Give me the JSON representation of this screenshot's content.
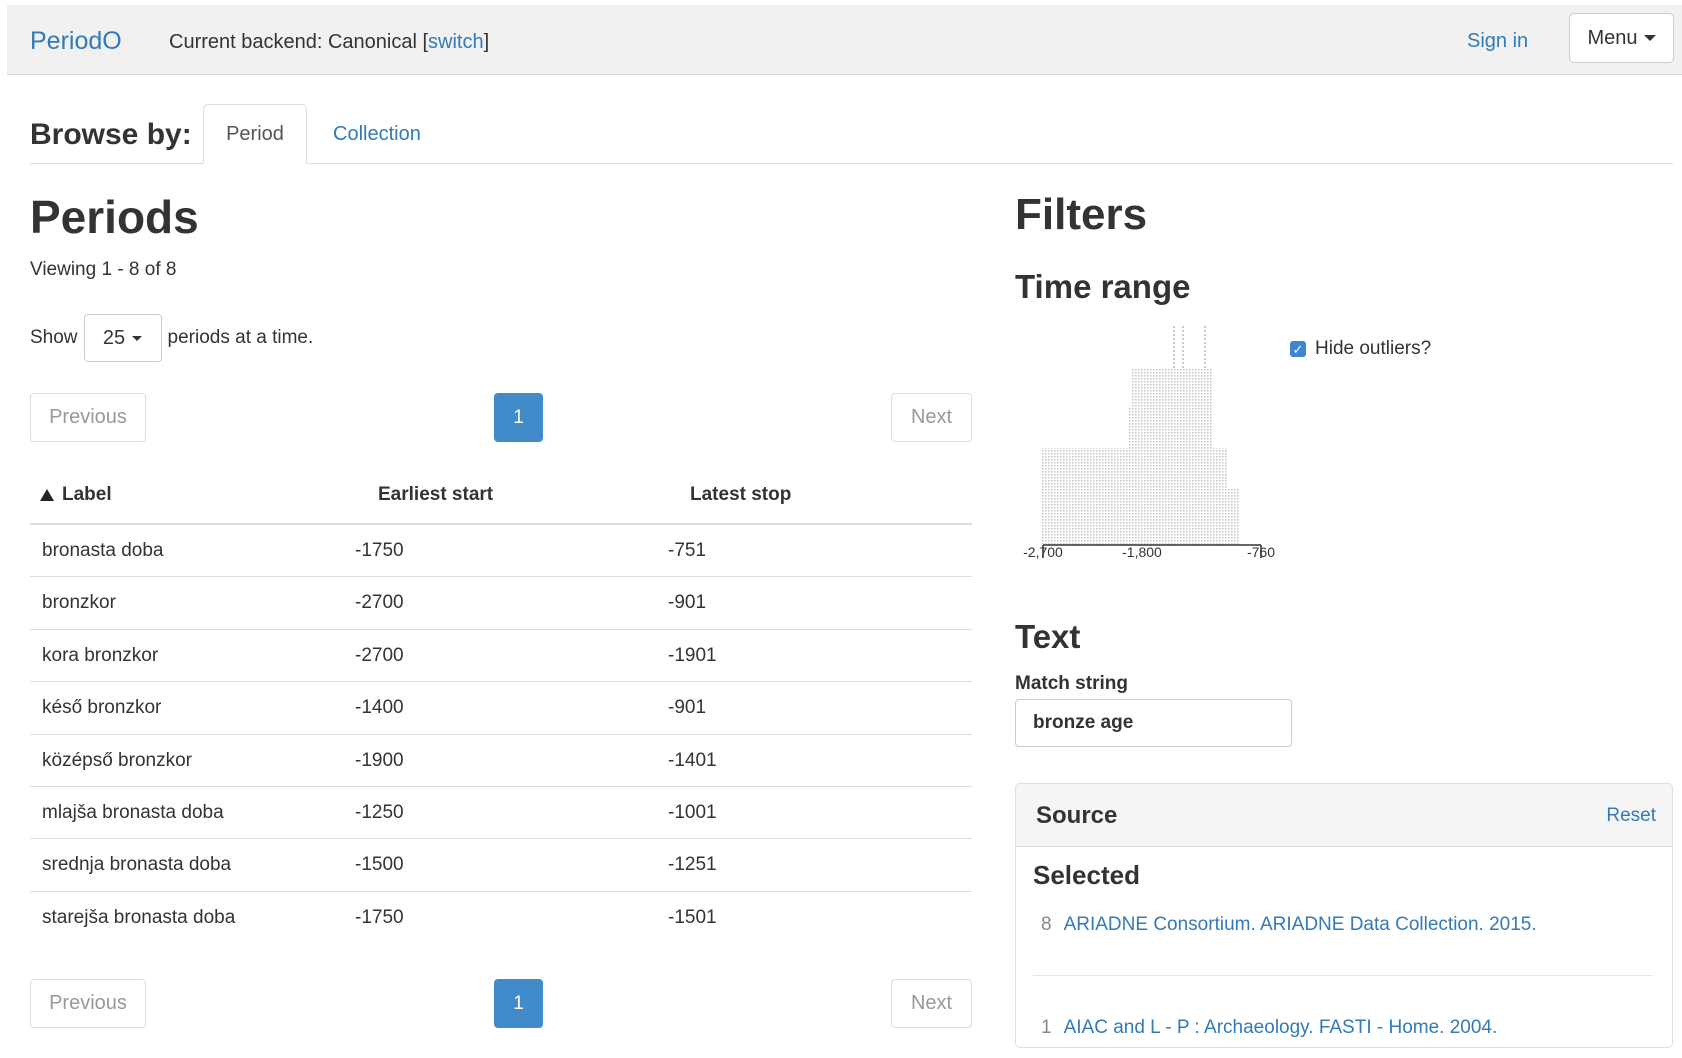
{
  "navbar": {
    "brand": "PeriodO",
    "backend_prefix": "Current backend: Canonical [",
    "backend_switch": "switch",
    "backend_suffix": "]",
    "sign_in": "Sign in",
    "menu": "Menu"
  },
  "browse": {
    "label": "Browse by:",
    "tabs": [
      {
        "label": "Period",
        "active": true
      },
      {
        "label": "Collection",
        "active": false
      }
    ]
  },
  "periods": {
    "title": "Periods",
    "viewing": "Viewing 1 - 8 of 8",
    "show_prefix": "Show",
    "show_value": "25",
    "show_suffix": "periods at a time.",
    "pager": {
      "previous": "Previous",
      "page": "1",
      "next": "Next"
    },
    "columns": {
      "label": "Label",
      "earliest_start": "Earliest start",
      "latest_stop": "Latest stop"
    },
    "rows": [
      {
        "label": "bronasta doba",
        "start": "-1750",
        "stop": "-751"
      },
      {
        "label": "bronzkor",
        "start": "-2700",
        "stop": "-901"
      },
      {
        "label": "kora bronzkor",
        "start": "-2700",
        "stop": "-1901"
      },
      {
        "label": "késő bronzkor",
        "start": "-1400",
        "stop": "-901"
      },
      {
        "label": "középső bronzkor",
        "start": "-1900",
        "stop": "-1401"
      },
      {
        "label": "mlajša bronasta doba",
        "start": "-1250",
        "stop": "-1001"
      },
      {
        "label": "srednja bronasta doba",
        "start": "-1500",
        "stop": "-1251"
      },
      {
        "label": "starejša bronasta doba",
        "start": "-1750",
        "stop": "-1501"
      }
    ]
  },
  "filters": {
    "title": "Filters",
    "time_range": {
      "title": "Time range",
      "hide_outliers_label": "Hide outliers?",
      "hide_outliers_checked": true,
      "axis_ticks": [
        "-2,700",
        "-1,800",
        "-760"
      ]
    },
    "text": {
      "title": "Text",
      "match_label": "Match string",
      "match_value": "bronze age"
    },
    "source": {
      "title": "Source",
      "reset": "Reset",
      "selected_title": "Selected",
      "items": [
        {
          "count": "8",
          "label": "ARIADNE Consortium. ARIADNE Data Collection. 2015."
        },
        {
          "count": "1",
          "label": "AIAC and L - P : Archaeology. FASTI - Home. 2004."
        }
      ]
    }
  },
  "colors": {
    "accent": "#337ab7",
    "active_page": "#428bca",
    "checkbox": "#3f85d6"
  }
}
